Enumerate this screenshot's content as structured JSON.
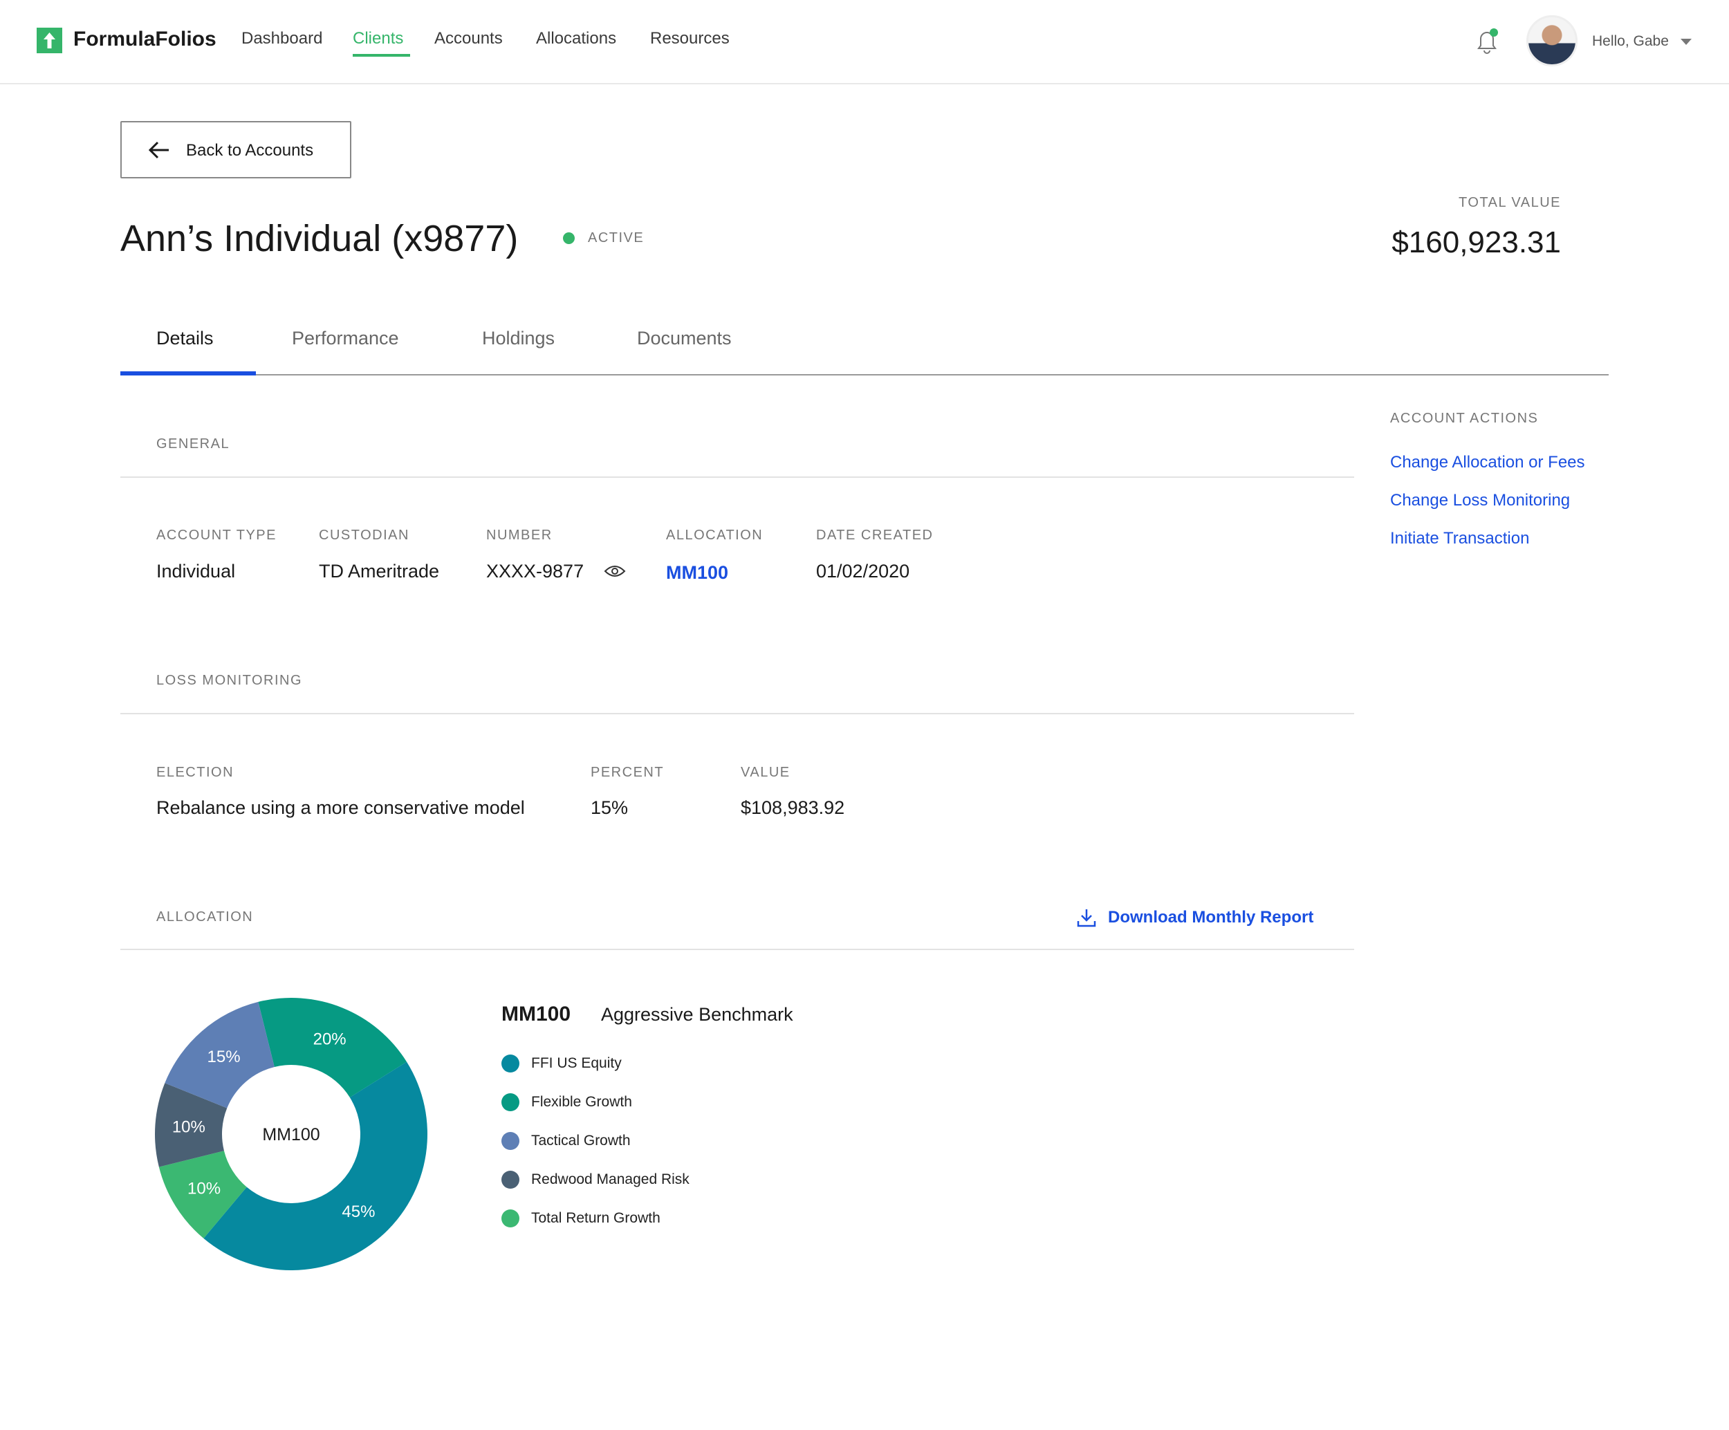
{
  "header": {
    "brand": "FormulaFolios",
    "nav": [
      "Dashboard",
      "Clients",
      "Accounts",
      "Allocations",
      "Resources"
    ],
    "active_nav": "Clients",
    "greeting": "Hello, Gabe",
    "accent": "#35b56a"
  },
  "back_button": "Back to Accounts",
  "account": {
    "title": "Ann’s Individual (x9877)",
    "status": "ACTIVE",
    "total_value_label": "TOTAL VALUE",
    "total_value": "$160,923.31"
  },
  "tabs": [
    "Details",
    "Performance",
    "Holdings",
    "Documents"
  ],
  "general": {
    "heading": "GENERAL",
    "labels": [
      "ACCOUNT TYPE",
      "CUSTODIAN",
      "NUMBER",
      "ALLOCATION",
      "DATE CREATED"
    ],
    "values": [
      "Individual",
      "TD Ameritrade",
      "XXXX-9877",
      "MM100",
      "01/02/2020"
    ]
  },
  "loss": {
    "heading": "LOSS MONITORING",
    "labels": [
      "ELECTION",
      "PERCENT",
      "VALUE"
    ],
    "values": [
      "Rebalance using a more conservative model",
      "15%",
      "$108,983.92"
    ]
  },
  "allocation": {
    "heading": "ALLOCATION",
    "download": "Download Monthly Report",
    "model": "MM100",
    "benchmark": "Aggressive Benchmark"
  },
  "actions": {
    "heading": "ACCOUNT ACTIONS",
    "links": [
      "Change Allocation or Fees",
      "Change Loss Monitoring",
      "Initiate Transaction"
    ]
  },
  "chart_data": {
    "type": "pie",
    "center_label": "MM100",
    "start_angle_deg": -14,
    "slices": [
      {
        "name": "Flexible Growth",
        "value": 20,
        "label": "20%",
        "color": "#069a83"
      },
      {
        "name": "FFI US Equity",
        "value": 45,
        "label": "45%",
        "color": "#06899f"
      },
      {
        "name": "Total Return Growth",
        "value": 10,
        "label": "10%",
        "color": "#3bb872"
      },
      {
        "name": "Redwood Managed Risk",
        "value": 10,
        "label": "10%",
        "color": "#4a6074"
      },
      {
        "name": "Tactical Growth",
        "value": 15,
        "label": "15%",
        "color": "#5e7fb5"
      }
    ],
    "legend": [
      "FFI US Equity",
      "Flexible Growth",
      "Tactical Growth",
      "Redwood Managed Risk",
      "Total Return Growth"
    ]
  }
}
